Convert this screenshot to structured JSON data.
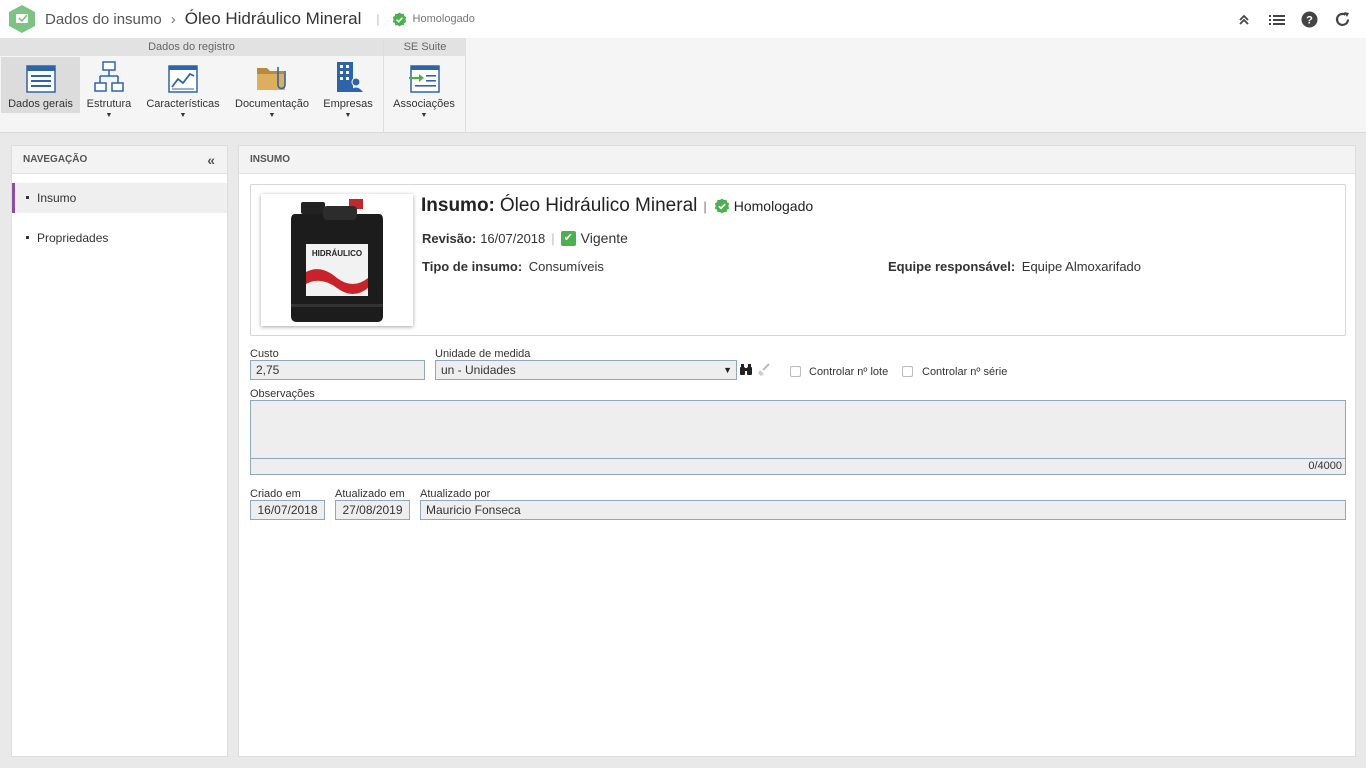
{
  "header": {
    "breadcrumb_root": "Dados do insumo",
    "title": "Óleo Hidráulico Mineral",
    "status": "Homologado"
  },
  "toolbar_icons": [
    "collapse-up-icon",
    "list-icon",
    "help-icon",
    "refresh-icon"
  ],
  "ribbon": {
    "groups": [
      {
        "label": "Dados do registro"
      },
      {
        "label": "SE Suite"
      }
    ],
    "buttons": [
      {
        "label": "Dados gerais",
        "icon": "form-icon",
        "active": true
      },
      {
        "label": "Estrutura",
        "icon": "structure-icon"
      },
      {
        "label": "Características",
        "icon": "chart-icon"
      },
      {
        "label": "Documentação",
        "icon": "folder-clip-icon"
      },
      {
        "label": "Empresas",
        "icon": "building-icon"
      },
      {
        "label": "Associações",
        "icon": "association-icon"
      }
    ]
  },
  "navigation": {
    "title": "NAVEGAÇÃO",
    "items": [
      {
        "label": "Insumo",
        "active": true
      },
      {
        "label": "Propriedades"
      }
    ]
  },
  "main": {
    "panel_title": "INSUMO",
    "card": {
      "title_label": "Insumo:",
      "title_value": "Óleo Hidráulico Mineral",
      "status": "Homologado",
      "revision_label": "Revisão:",
      "revision_value": "16/07/2018",
      "validity": "Vigente",
      "type_label": "Tipo de insumo:",
      "type_value": "Consumíveis",
      "team_label": "Equipe responsável:",
      "team_value": "Equipe Almoxarifado",
      "photo_label": "HIDRÁULICO"
    },
    "form": {
      "cost_label": "Custo",
      "cost_value": "2,75",
      "unit_label": "Unidade de medida",
      "unit_value": "un - Unidades",
      "lot_label": "Controlar nº lote",
      "serial_label": "Controlar nº série",
      "notes_label": "Observações",
      "notes_counter": "0/4000",
      "created_label": "Criado em",
      "created_value": "16/07/2018",
      "updated_label": "Atualizado em",
      "updated_value": "27/08/2019",
      "updated_by_label": "Atualizado por",
      "updated_by_value": "Mauricio Fonseca"
    }
  },
  "colors": {
    "accent_nav": "#8a4fa0",
    "status_green": "#4caf50",
    "logo_green": "#7dc383",
    "field_border": "#8fa8be"
  }
}
